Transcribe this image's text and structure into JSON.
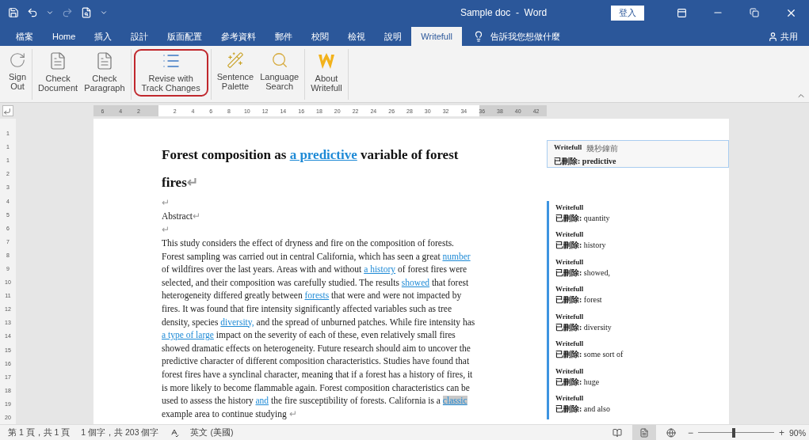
{
  "window": {
    "title": "Sample doc  -  Word",
    "sign_in": "登入"
  },
  "tabs": [
    {
      "label": "檔案",
      "selected": false
    },
    {
      "label": "Home",
      "selected": false
    },
    {
      "label": "插入",
      "selected": false
    },
    {
      "label": "設計",
      "selected": false
    },
    {
      "label": "版面配置",
      "selected": false
    },
    {
      "label": "參考資料",
      "selected": false
    },
    {
      "label": "郵件",
      "selected": false
    },
    {
      "label": "校閱",
      "selected": false
    },
    {
      "label": "檢視",
      "selected": false
    },
    {
      "label": "說明",
      "selected": false
    },
    {
      "label": "Writefull",
      "selected": true
    }
  ],
  "tell_me": "告訴我您想做什麼",
  "share": "共用",
  "ribbon_groups": [
    {
      "buttons": [
        {
          "kind": "sign-out",
          "label": "Sign\nOut",
          "highlighted": false
        }
      ]
    },
    {
      "buttons": [
        {
          "kind": "document",
          "label": "Check\nDocument",
          "highlighted": false
        },
        {
          "kind": "document",
          "label": "Check\nParagraph",
          "highlighted": false
        }
      ]
    },
    {
      "buttons": [
        {
          "kind": "revise",
          "label": "Revise with\nTrack Changes",
          "highlighted": true
        }
      ]
    },
    {
      "buttons": [
        {
          "kind": "palette",
          "label": "Sentence\nPalette",
          "highlighted": false
        },
        {
          "kind": "search",
          "label": "Language\nSearch",
          "highlighted": false
        }
      ]
    },
    {
      "buttons": [
        {
          "kind": "logo",
          "label": "About\nWritefull",
          "highlighted": false
        }
      ]
    }
  ],
  "ruler": {
    "left_labels": [
      "6",
      "4",
      "2"
    ],
    "labels": [
      "2",
      "4",
      "6",
      "8",
      "10",
      "12",
      "14",
      "16",
      "18",
      "20",
      "22",
      "24",
      "26",
      "28",
      "30",
      "32",
      "34",
      "36",
      "38",
      "40",
      "42"
    ]
  },
  "vertical_ruler": {
    "labels": [
      "1",
      "1",
      "1",
      "2",
      "3",
      "4",
      "5",
      "6",
      "7",
      "8",
      "9",
      "10",
      "11",
      "12",
      "13",
      "14",
      "15",
      "16",
      "17",
      "18",
      "19",
      "20"
    ]
  },
  "document": {
    "blocks": [
      {
        "kind": "heading",
        "segments": [
          {
            "kind": "text",
            "text": "Forest composition as "
          },
          {
            "kind": "insert",
            "text": "a predictive",
            "highlighted": false
          },
          {
            "kind": "text",
            "text": " variable of forest fires"
          },
          {
            "kind": "mark",
            "text": "↵"
          }
        ]
      },
      {
        "kind": "plain",
        "segments": [
          {
            "kind": "mark",
            "text": "↵"
          }
        ]
      },
      {
        "kind": "plain",
        "segments": [
          {
            "kind": "text",
            "text": "Abstract"
          },
          {
            "kind": "mark",
            "text": "↵"
          }
        ]
      },
      {
        "kind": "plain",
        "segments": [
          {
            "kind": "mark",
            "text": "↵"
          }
        ]
      },
      {
        "kind": "body",
        "segments": [
          {
            "kind": "text",
            "text": "This study considers the effect of dryness and fire on the composition of forests. Forest sampling was carried out in central California, which has seen a great "
          },
          {
            "kind": "insert",
            "text": "number",
            "highlighted": false
          },
          {
            "kind": "text",
            "text": " of wildfires over the last years. Areas with and without "
          },
          {
            "kind": "insert",
            "text": "a history",
            "highlighted": false
          },
          {
            "kind": "text",
            "text": " of forest fires were selected, and their composition was carefully studied. The results "
          },
          {
            "kind": "insert",
            "text": "showed",
            "highlighted": false
          },
          {
            "kind": "text",
            "text": " that forest heterogeneity differed greatly between "
          },
          {
            "kind": "insert",
            "text": "forests",
            "highlighted": false
          },
          {
            "kind": "text",
            "text": " that were and were not impacted by fires. It was found that fire intensity significantly affected variables such as tree density, species "
          },
          {
            "kind": "insert",
            "text": "diversity,",
            "highlighted": false
          },
          {
            "kind": "text",
            "text": " and the spread of unburned patches. While fire intensity has "
          },
          {
            "kind": "insert",
            "text": "a type of ",
            "highlighted": false
          },
          {
            "kind": "insert",
            "text": "large",
            "highlighted": false
          },
          {
            "kind": "text",
            "text": " impact on the severity of each of these, even relatively small fires showed dramatic effects on heterogeneity. Future research should aim to uncover the predictive character of different composition characteristics. Studies have found that forest fires have a synclinal character, meaning that if a forest has a history of fires, it is more likely to become flammable again. Forest composition characteristics can be used to assess the history "
          },
          {
            "kind": "insert",
            "text": "and",
            "highlighted": false
          },
          {
            "kind": "text",
            "text": " the fire susceptibility of forests. California is a "
          },
          {
            "kind": "insert",
            "text": "classic",
            "highlighted": true
          },
          {
            "kind": "text",
            "text": " example area to continue studying "
          },
          {
            "kind": "mark",
            "text": "↵"
          }
        ]
      }
    ]
  },
  "comments": [
    {
      "author": "Writefull",
      "time": "幾秒鐘前",
      "label": "已刪除:",
      "text": "predictive",
      "selected": true
    },
    {
      "author": "Writefull",
      "label": "已刪除:",
      "text": "quantity",
      "selected": false
    },
    {
      "author": "Writefull",
      "label": "已刪除:",
      "text": "history",
      "selected": false
    },
    {
      "author": "Writefull",
      "label": "已刪除:",
      "text": "showed,",
      "selected": false
    },
    {
      "author": "Writefull",
      "label": "已刪除:",
      "text": "forest",
      "selected": false
    },
    {
      "author": "Writefull",
      "label": "已刪除:",
      "text": "diversity",
      "selected": false
    },
    {
      "author": "Writefull",
      "label": "已刪除:",
      "text": "some sort of",
      "selected": false
    },
    {
      "author": "Writefull",
      "label": "已刪除:",
      "text": "huge",
      "selected": false
    },
    {
      "author": "Writefull",
      "label": "已刪除:",
      "text": "and also",
      "selected": false
    }
  ],
  "status_bar": {
    "page": "第 1 頁，共 1 頁",
    "words": "1 個字，共 203 個字",
    "language": "英文 (美國)",
    "views": [
      {
        "kind": "read",
        "selected": false
      },
      {
        "kind": "print",
        "selected": true
      },
      {
        "kind": "web",
        "selected": false
      }
    ],
    "zoom_out": "−",
    "zoom_in": "+",
    "zoom": {
      "level": 0.45,
      "value": "90%"
    }
  }
}
